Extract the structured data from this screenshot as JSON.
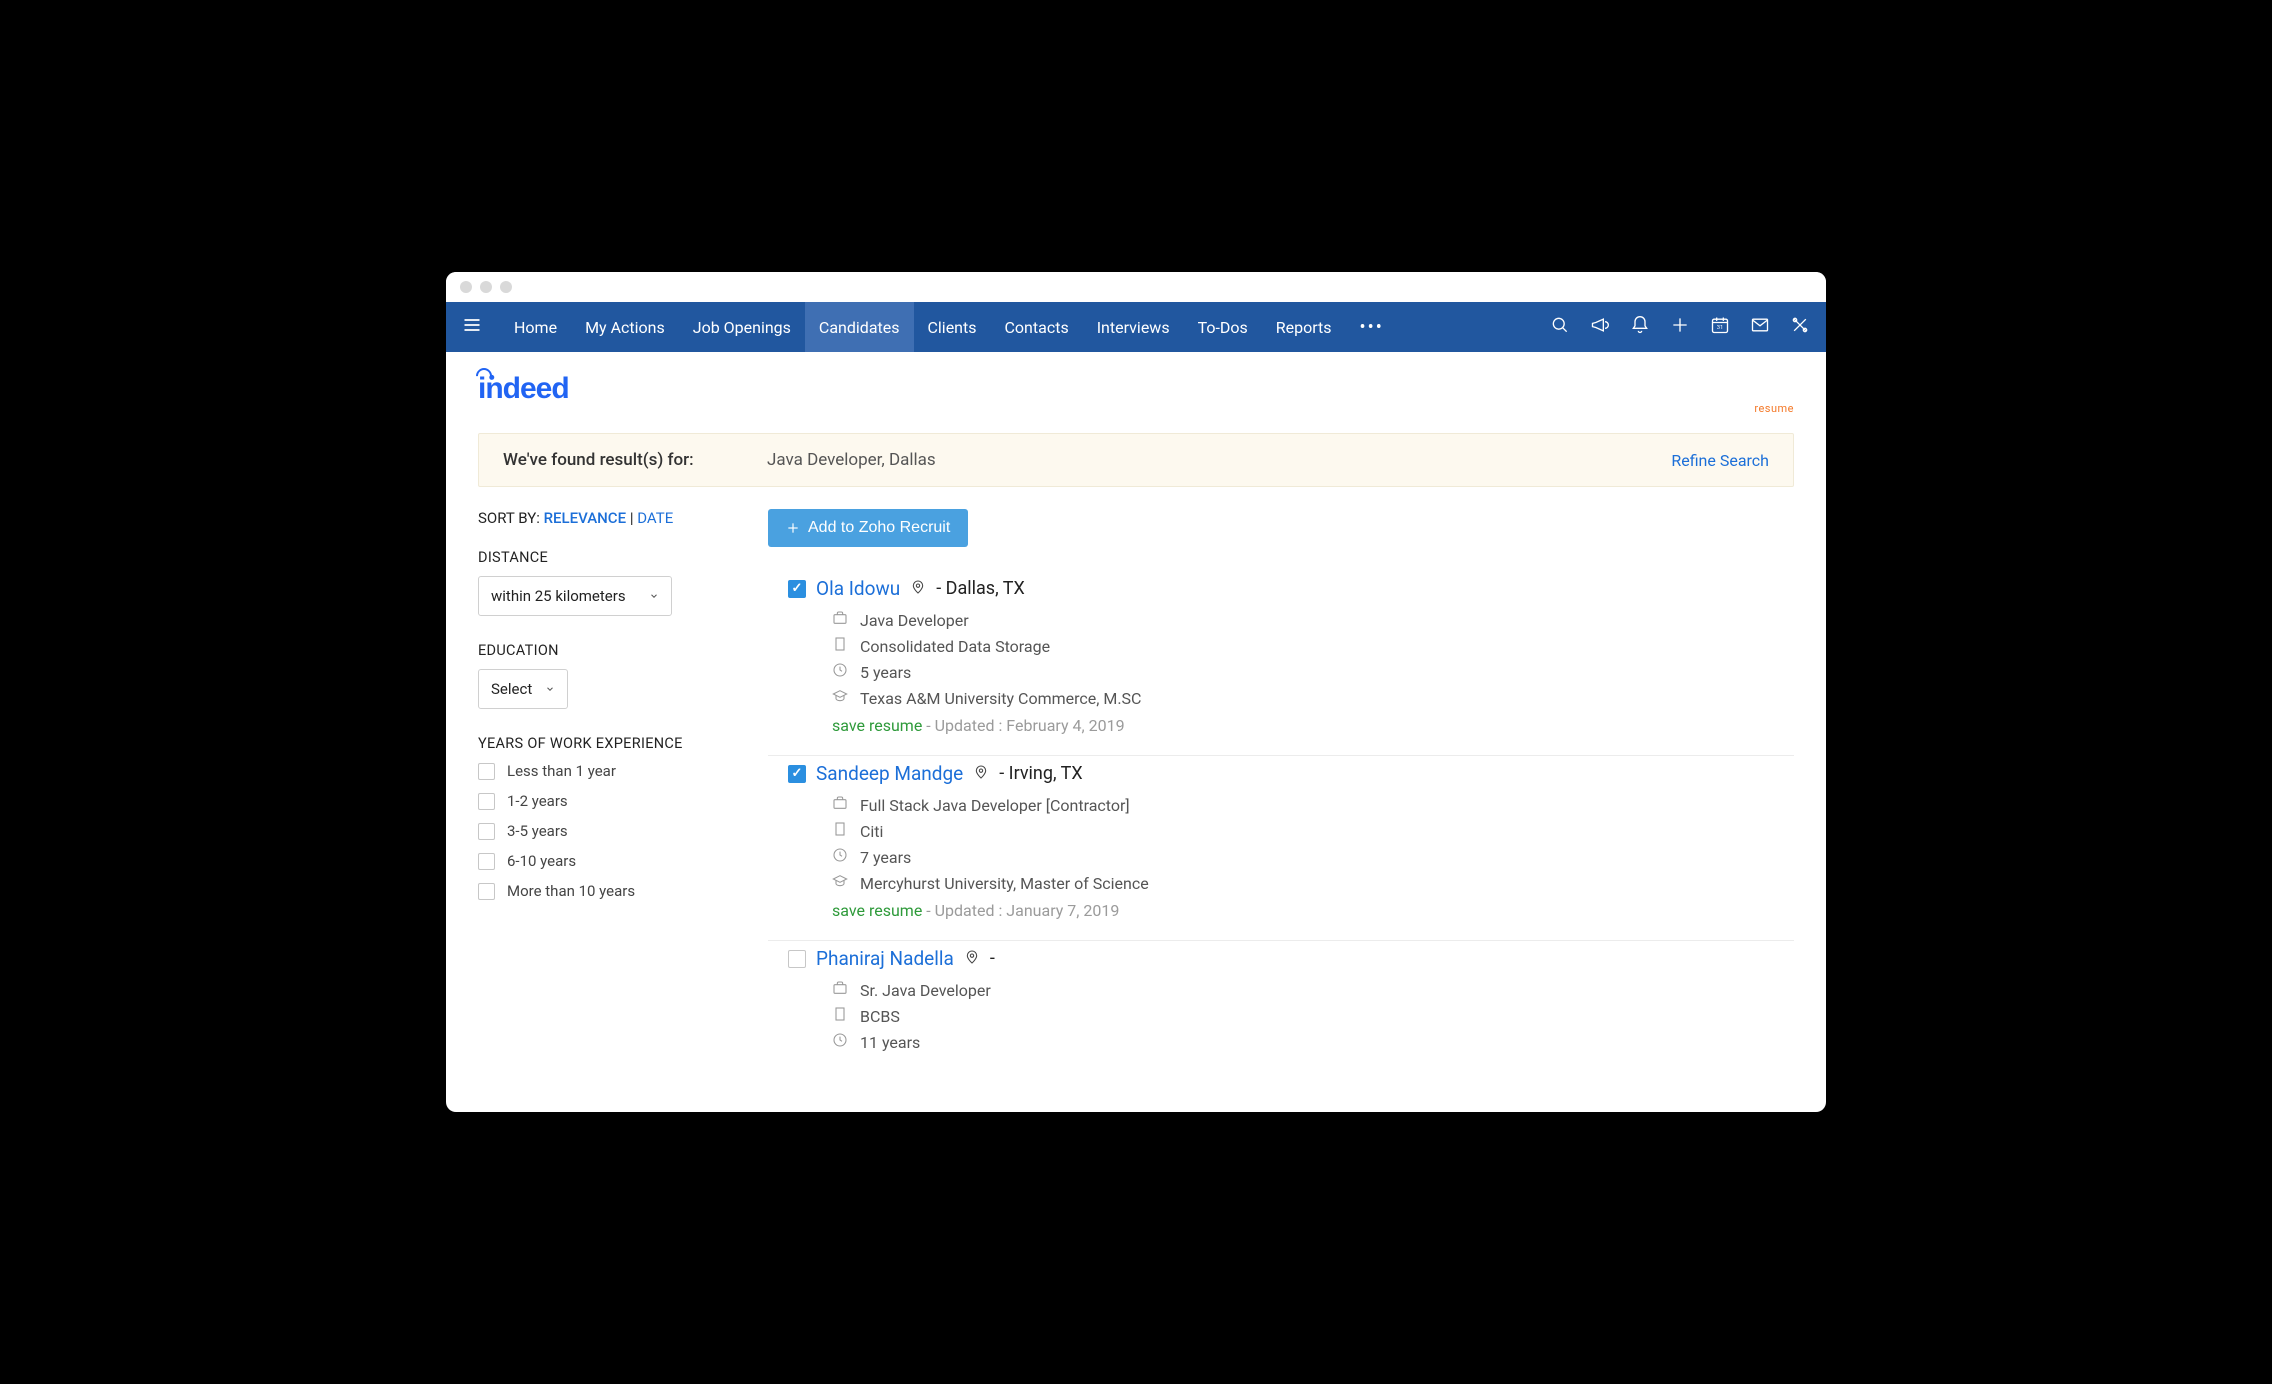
{
  "nav": {
    "items": [
      "Home",
      "My Actions",
      "Job Openings",
      "Candidates",
      "Clients",
      "Contacts",
      "Interviews",
      "To-Dos",
      "Reports"
    ],
    "active_index": 3
  },
  "brand": {
    "main": "indeed",
    "sub": "resume"
  },
  "resultbar": {
    "label": "We've found result(s) for:",
    "query": "Java Developer, Dallas",
    "refine": "Refine Search"
  },
  "sort": {
    "label": "SORT BY:",
    "relevance": "RELEVANCE",
    "sep": "|",
    "date": "DATE"
  },
  "facets": {
    "distance": {
      "title": "DISTANCE",
      "value": "within 25 kilometers"
    },
    "education": {
      "title": "EDUCATION",
      "value": "Select"
    },
    "experience": {
      "title": "YEARS OF WORK EXPERIENCE",
      "options": [
        "Less than 1 year",
        "1-2 years",
        "3-5 years",
        "6-10 years",
        "More than 10 years"
      ]
    }
  },
  "add_button": "Add to Zoho Recruit",
  "save_label": "save resume",
  "results": [
    {
      "checked": true,
      "name": "Ola Idowu",
      "location": "Dallas, TX",
      "title": "Java Developer",
      "company": "Consolidated Data Storage",
      "years": "5 years",
      "edu": "Texas A&M University Commerce, M.SC",
      "updated": "Updated : February 4, 2019"
    },
    {
      "checked": true,
      "name": "Sandeep Mandge",
      "location": "Irving, TX",
      "title": "Full Stack Java Developer [Contractor]",
      "company": "Citi",
      "years": "7 years",
      "edu": "Mercyhurst University, Master of Science",
      "updated": "Updated : January 7, 2019"
    },
    {
      "checked": false,
      "name": "Phaniraj Nadella",
      "location": "",
      "title": "Sr. Java Developer",
      "company": "BCBS",
      "years": "11 years",
      "edu": "",
      "updated": ""
    }
  ]
}
